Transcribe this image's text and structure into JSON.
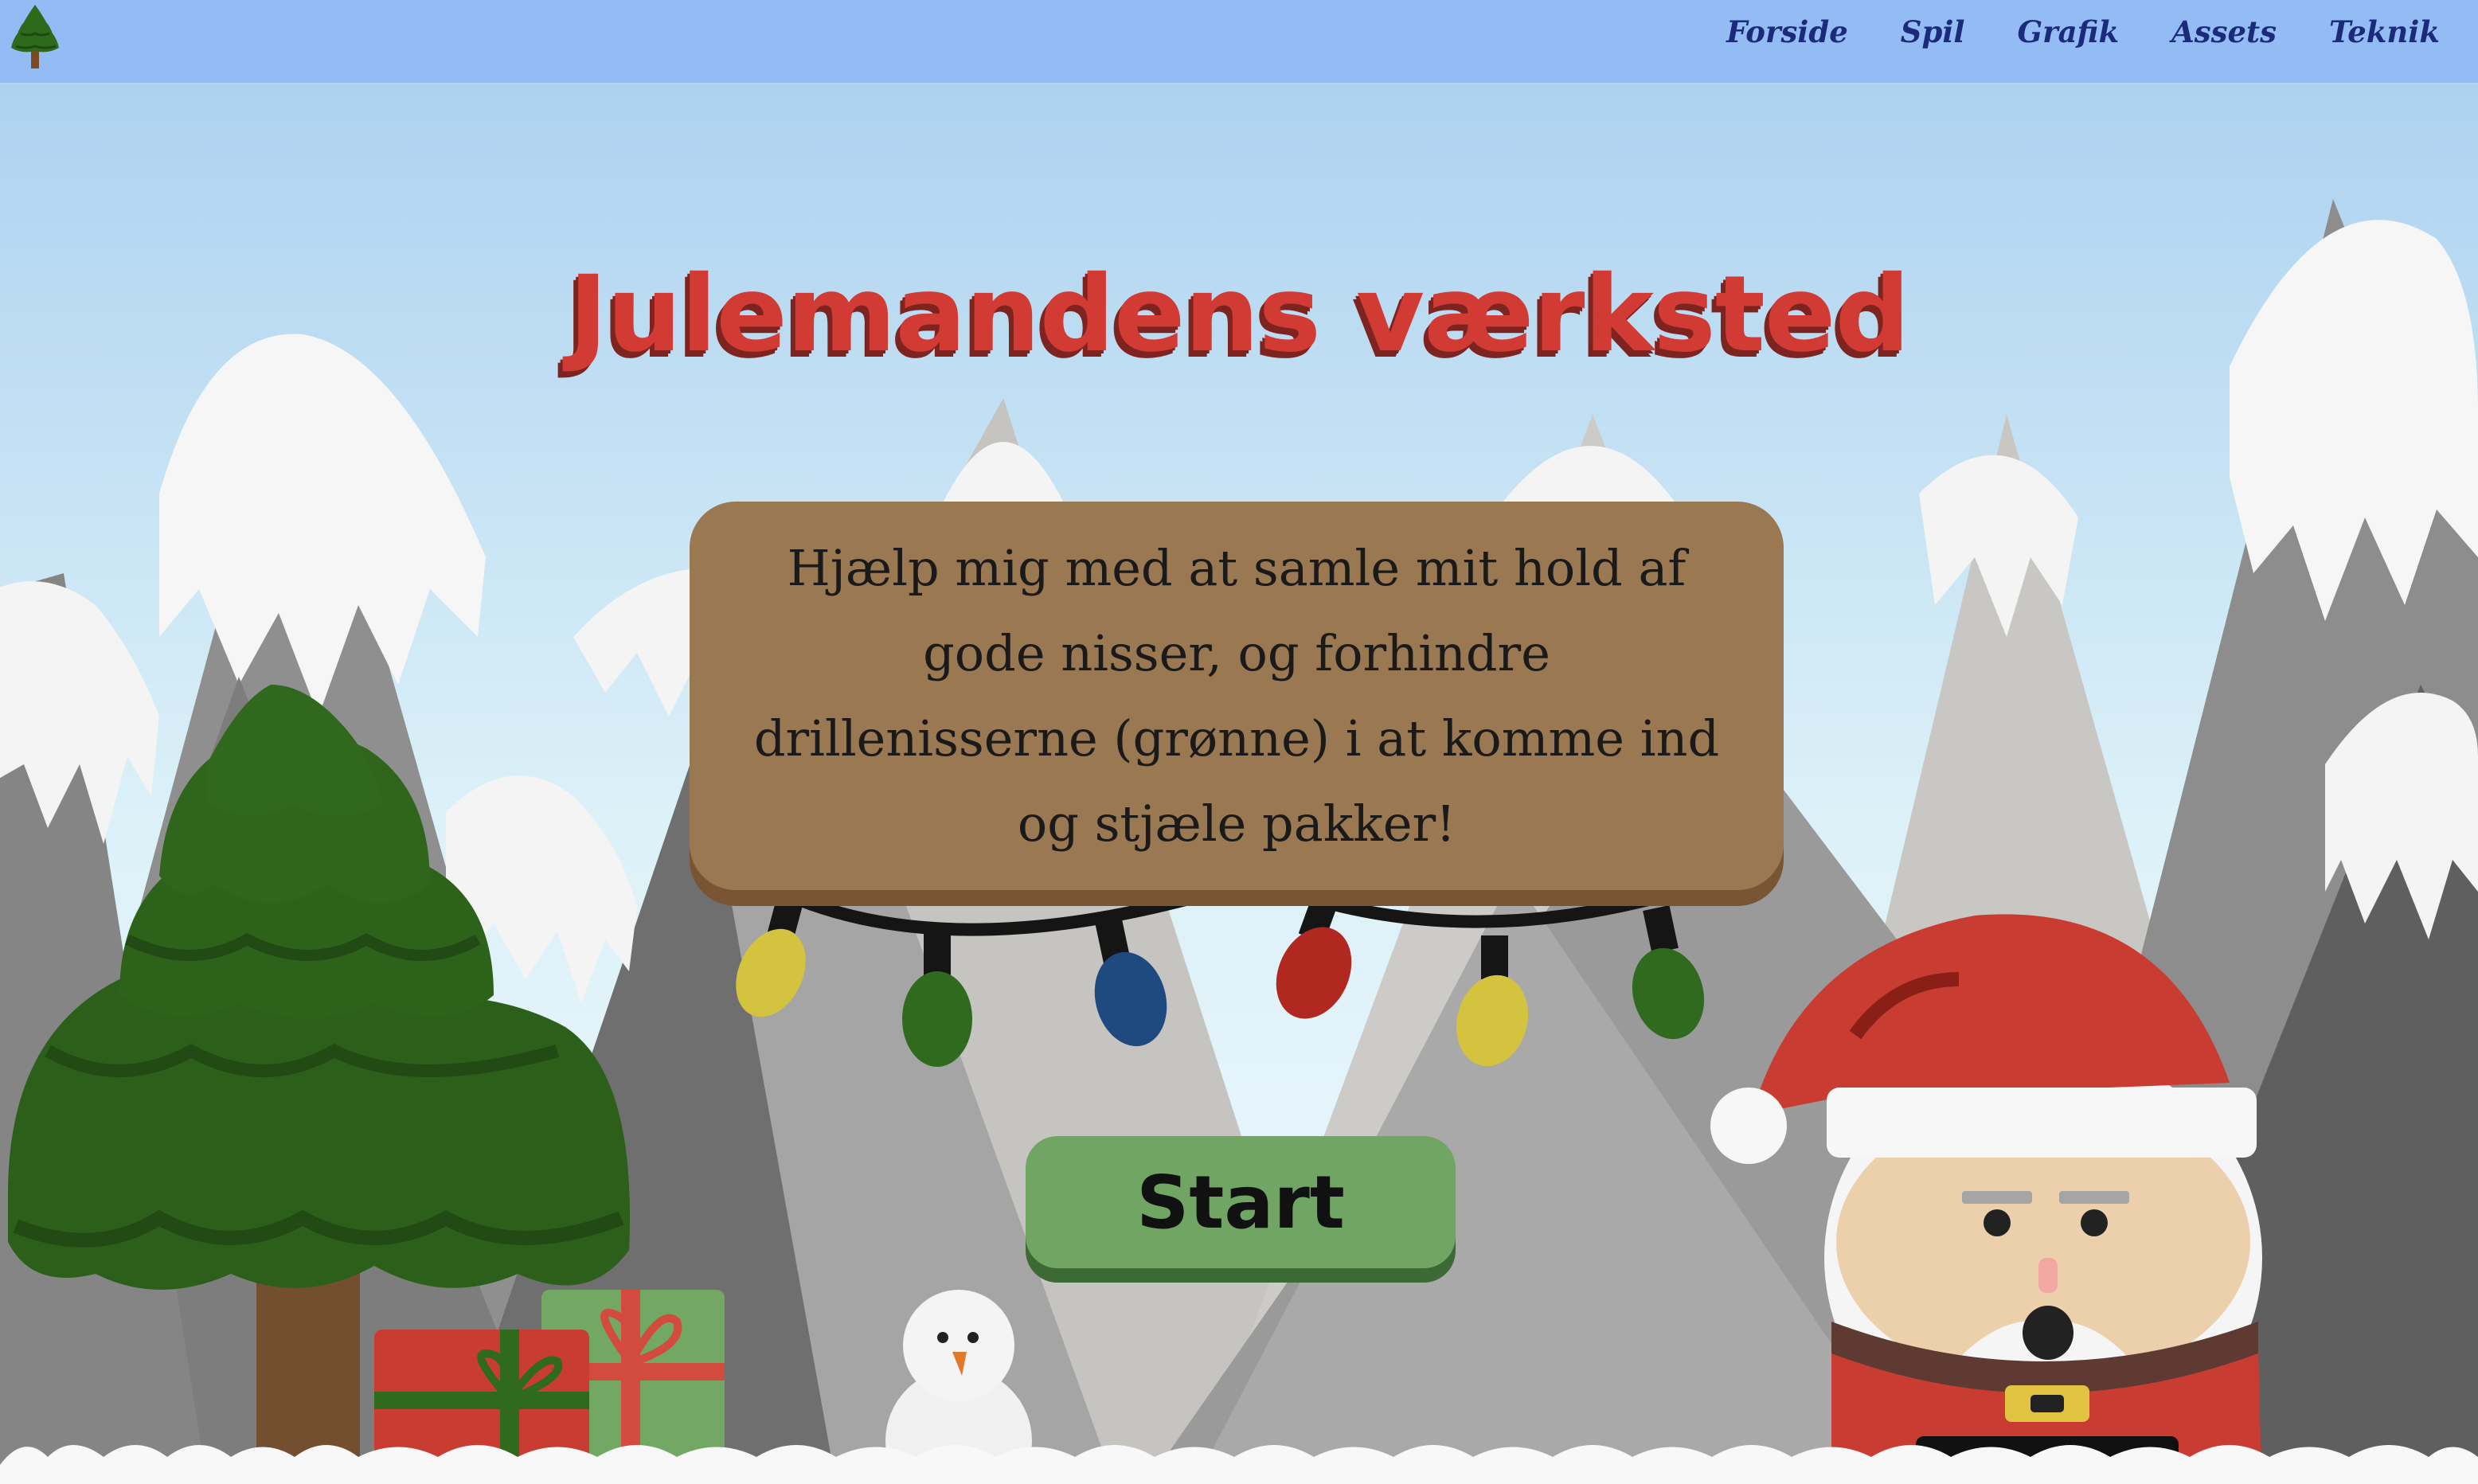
{
  "nav": {
    "logo_icon": "pine-tree-icon",
    "items": [
      {
        "label": "Forside"
      },
      {
        "label": "Spil"
      },
      {
        "label": "Grafik"
      },
      {
        "label": "Assets"
      },
      {
        "label": "Teknik"
      }
    ]
  },
  "title": "Julemandens værksted",
  "intro": "Hjælp mig med at samle mit hold af gode nisser, og forhindre drillenisserne (grønne) i at komme ind og stjæle pakker!",
  "start_label": "Start",
  "colors": {
    "sky_top": "#a7ceef",
    "nav_bar": "#93bcf4",
    "title_red": "#d13b34",
    "board_brown": "#9a7852",
    "button_green": "#71a563",
    "tree_green": "#2e6118"
  }
}
